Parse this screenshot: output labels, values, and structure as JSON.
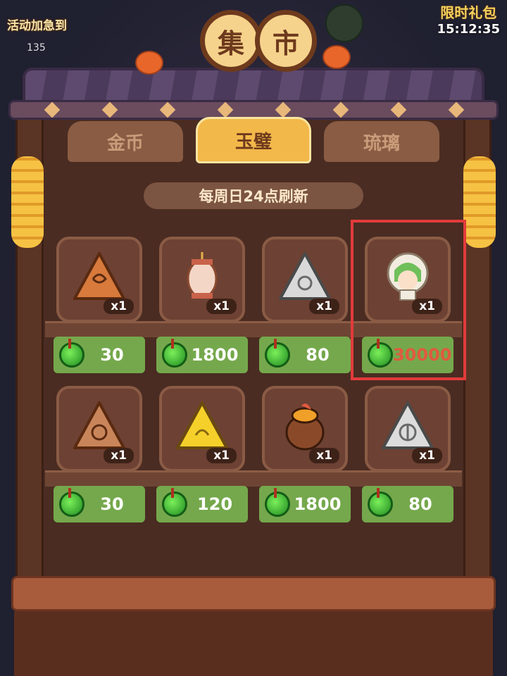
{
  "top": {
    "event_label": "活动加急到",
    "event_count": "135",
    "gift_label": "限时礼包",
    "timer": "15:12:35"
  },
  "title": {
    "char1": "集",
    "char2": "市"
  },
  "tabs": [
    {
      "label": "金币",
      "active": false
    },
    {
      "label": "玉璧",
      "active": true
    },
    {
      "label": "琉璃",
      "active": false
    }
  ],
  "refresh_notice": "每周日24点刷新",
  "currency_icon": "jade-coin-icon",
  "items": [
    {
      "icon": "bronze-triangle-token-icon",
      "qty": "x1",
      "price": "30"
    },
    {
      "icon": "lantern-icon",
      "qty": "x1",
      "price": "1800"
    },
    {
      "icon": "silver-triangle-token-icon",
      "qty": "x1",
      "price": "80"
    },
    {
      "icon": "character-avatar-icon",
      "qty": "x1",
      "price": "30000",
      "highlighted": true
    },
    {
      "icon": "bronze-flower-token-icon",
      "qty": "x1",
      "price": "30"
    },
    {
      "icon": "gold-triangle-token-icon",
      "qty": "x1",
      "price": "120"
    },
    {
      "icon": "treasure-jar-icon",
      "qty": "x1",
      "price": "1800"
    },
    {
      "icon": "silver-leaf-token-icon",
      "qty": "x1",
      "price": "80"
    }
  ],
  "colors": {
    "highlight_border": "#e23b3b",
    "price_bg": "#75a84c",
    "tab_active": "#f3b84a"
  }
}
